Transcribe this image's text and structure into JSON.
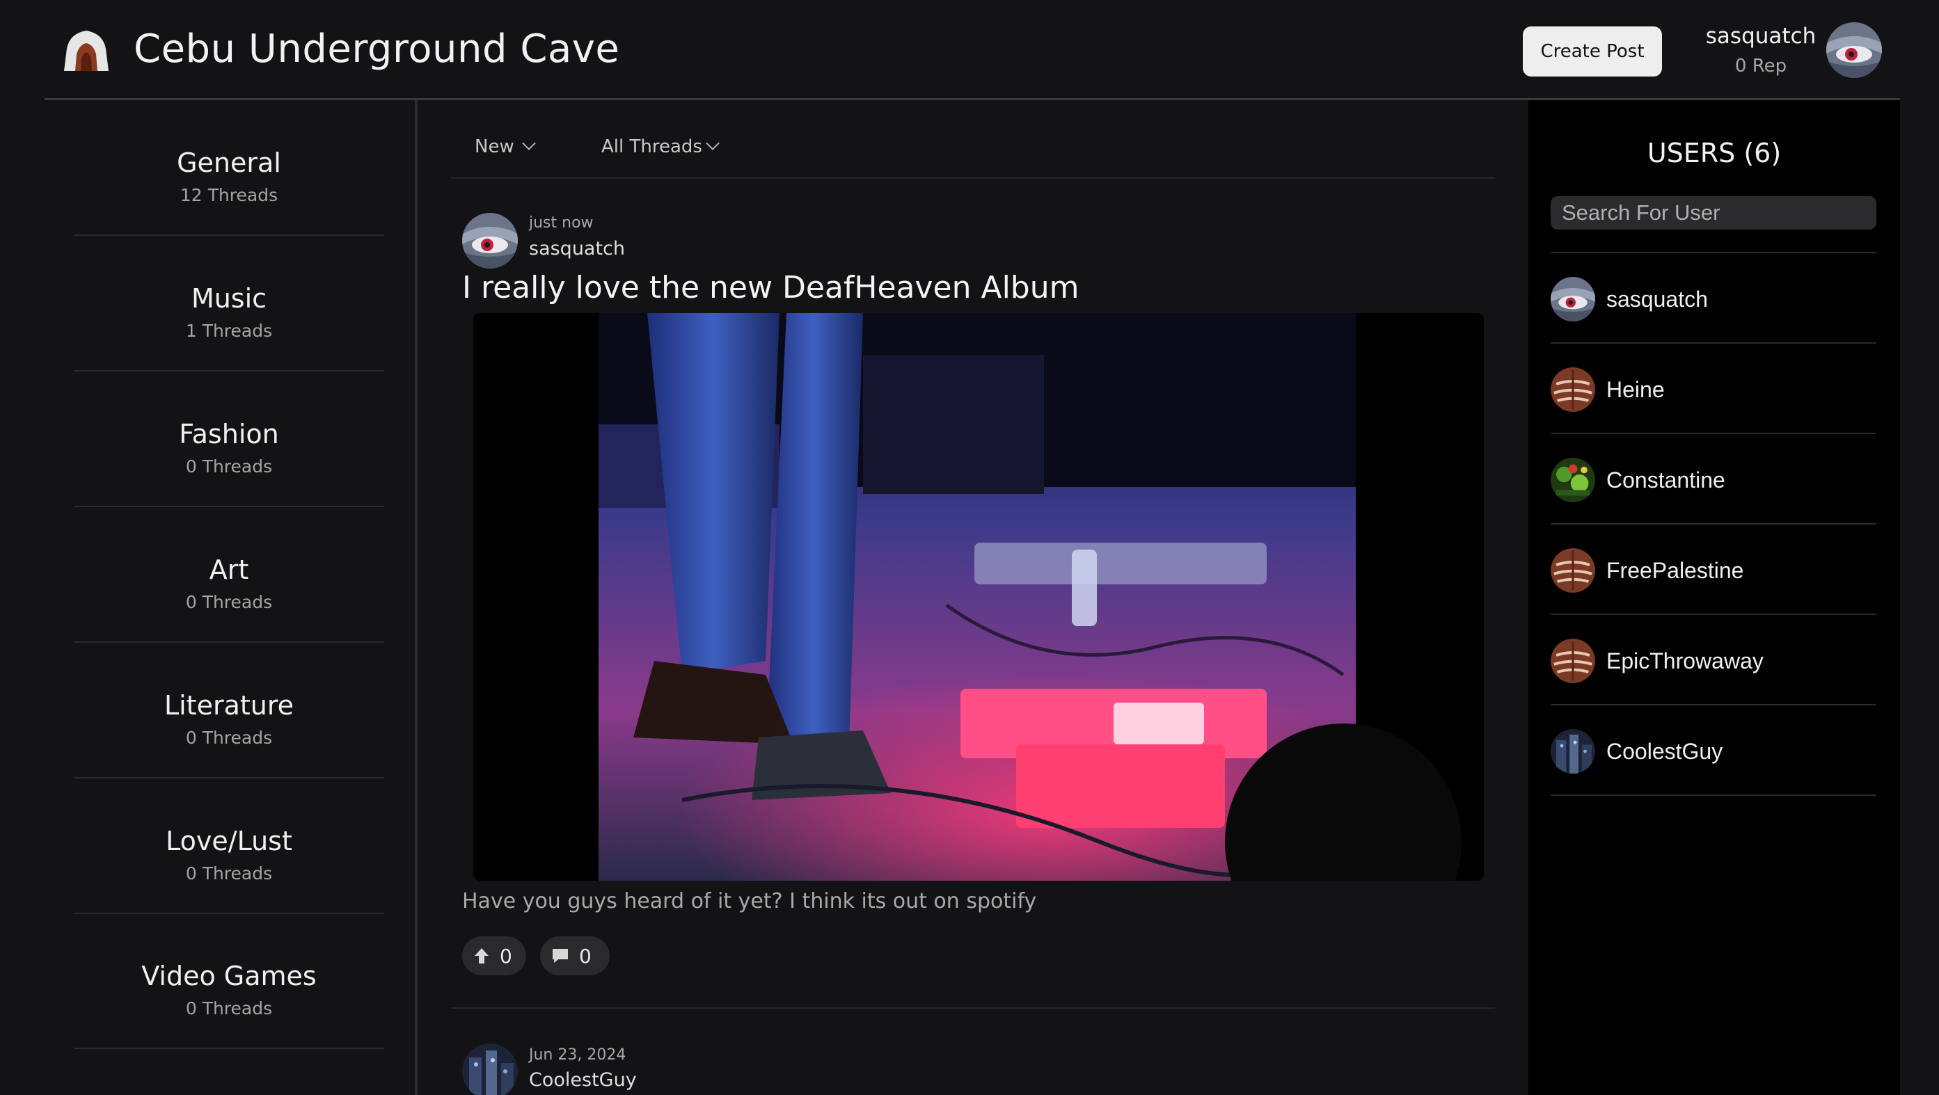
{
  "header": {
    "app_title": "Cebu Underground Cave",
    "create_post_label": "Create Post",
    "username": "sasquatch",
    "rep": "0 Rep"
  },
  "categories": [
    {
      "name": "General",
      "count": "12 Threads"
    },
    {
      "name": "Music",
      "count": "1 Threads"
    },
    {
      "name": "Fashion",
      "count": "0 Threads"
    },
    {
      "name": "Art",
      "count": "0 Threads"
    },
    {
      "name": "Literature",
      "count": "0 Threads"
    },
    {
      "name": "Love/Lust",
      "count": "0 Threads"
    },
    {
      "name": "Video Games",
      "count": "0 Threads"
    }
  ],
  "filters": {
    "sort": "New",
    "scope": "All Threads"
  },
  "posts": [
    {
      "time": "just now",
      "author": "sasquatch",
      "title": "I really love the new DeafHeaven Album",
      "body": "Have you guys heard of it yet? I think its out on spotify",
      "upvotes": "0",
      "comments": "0"
    },
    {
      "time": "Jun 23, 2024",
      "author": "CoolestGuy"
    }
  ],
  "users_panel": {
    "title": "USERS (6)",
    "search_placeholder": "Search For User",
    "users": [
      {
        "name": "sasquatch",
        "avatar": "eye-avatar"
      },
      {
        "name": "Heine",
        "avatar": "default-avatar"
      },
      {
        "name": "Constantine",
        "avatar": "green-avatar"
      },
      {
        "name": "FreePalestine",
        "avatar": "default-avatar"
      },
      {
        "name": "EpicThrowaway",
        "avatar": "default-avatar"
      },
      {
        "name": "CoolestGuy",
        "avatar": "night-avatar"
      }
    ]
  },
  "colors": {
    "background": "#131315",
    "panel": "#000000",
    "button": "#eeeeee",
    "pill": "#2a2a2d"
  }
}
